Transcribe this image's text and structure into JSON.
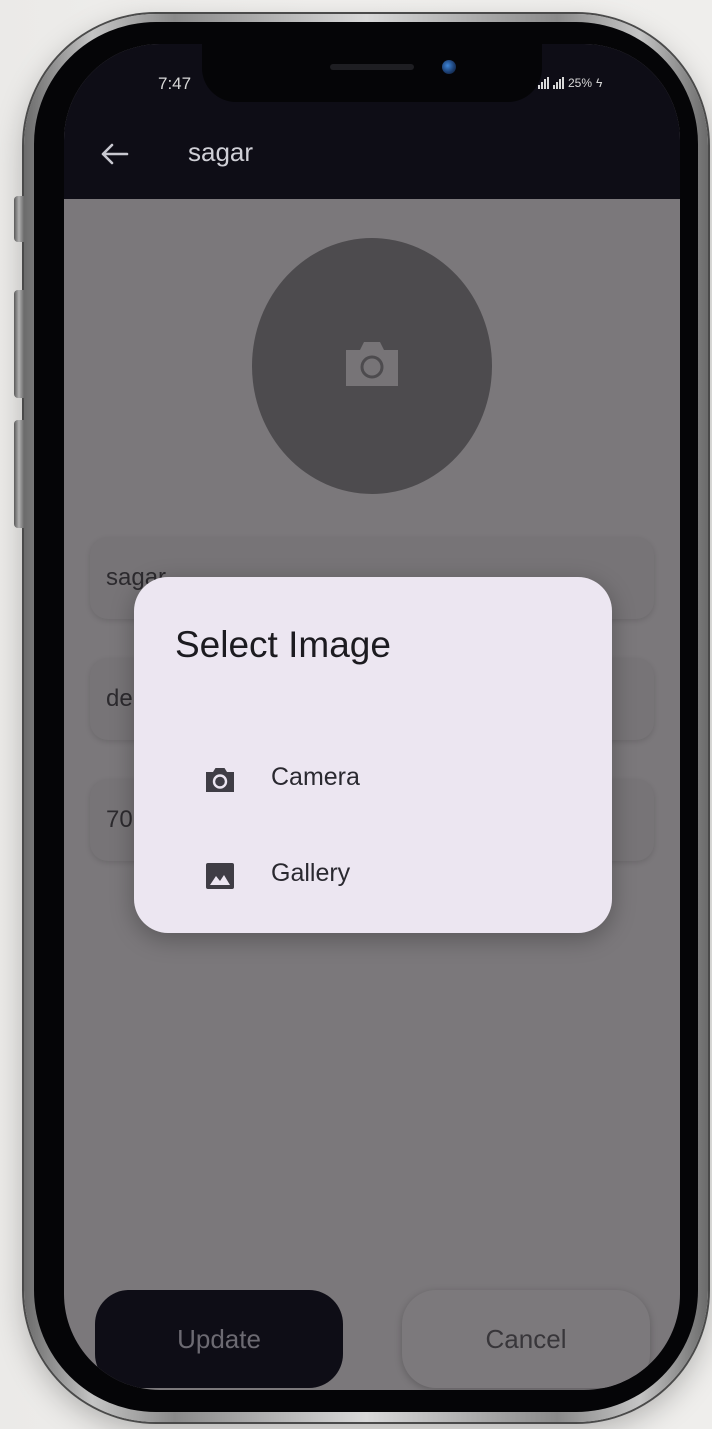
{
  "status_bar": {
    "time": "7:47",
    "battery": "25%"
  },
  "app_bar": {
    "title": "sagar"
  },
  "form": {
    "fields": [
      {
        "value": "sagar"
      },
      {
        "value": "de"
      },
      {
        "value": "70"
      }
    ]
  },
  "actions": {
    "update_label": "Update",
    "cancel_label": "Cancel"
  },
  "dialog": {
    "title": "Select Image",
    "options": [
      {
        "label": "Camera",
        "icon": "camera-icon"
      },
      {
        "label": "Gallery",
        "icon": "image-icon"
      }
    ]
  },
  "colors": {
    "app_bar": "#0e0d16",
    "scrim": "#7b787b",
    "dialog_surface": "#ece6f1"
  }
}
